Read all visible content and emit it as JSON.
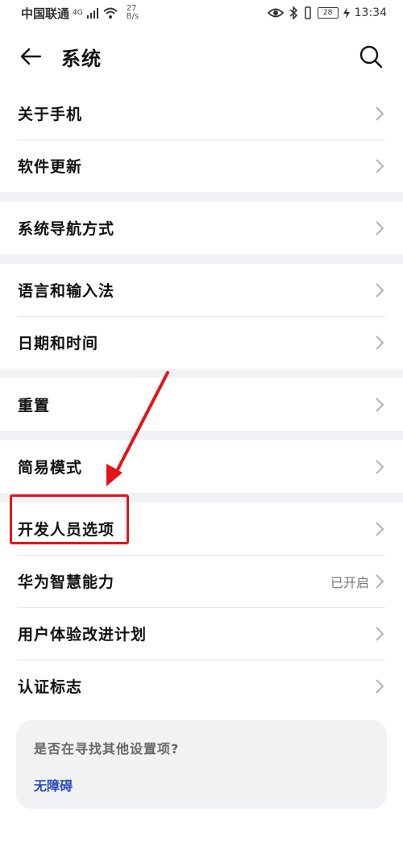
{
  "status_bar": {
    "carrier": "中国联通",
    "network": "4G",
    "speed_value": "27",
    "speed_unit": "B/s",
    "battery": "28",
    "time": "13:34"
  },
  "header": {
    "title": "系统"
  },
  "groups": [
    [
      "关于手机",
      "软件更新"
    ],
    [
      "系统导航方式"
    ],
    [
      "语言和输入法",
      "日期和时间"
    ],
    [
      "重置"
    ],
    [
      "简易模式"
    ],
    [
      "开发人员选项",
      "华为智慧能力",
      "用户体验改进计划",
      "认证标志"
    ]
  ],
  "items": {
    "about_phone": "关于手机",
    "software_update": "软件更新",
    "nav_mode": "系统导航方式",
    "language_input": "语言和输入法",
    "date_time": "日期和时间",
    "reset": "重置",
    "simple_mode": "简易模式",
    "developer_options": "开发人员选项",
    "huawei_ai": "华为智慧能力",
    "huawei_ai_value": "已开启",
    "ux_plan": "用户体验改进计划",
    "cert_marks": "认证标志"
  },
  "suggest": {
    "title": "是否在寻找其他设置项?",
    "link": "无障碍"
  },
  "colors": {
    "annotation": "#e3141a",
    "link": "#2a4bb8",
    "group_gap": "#f1f2f3"
  }
}
